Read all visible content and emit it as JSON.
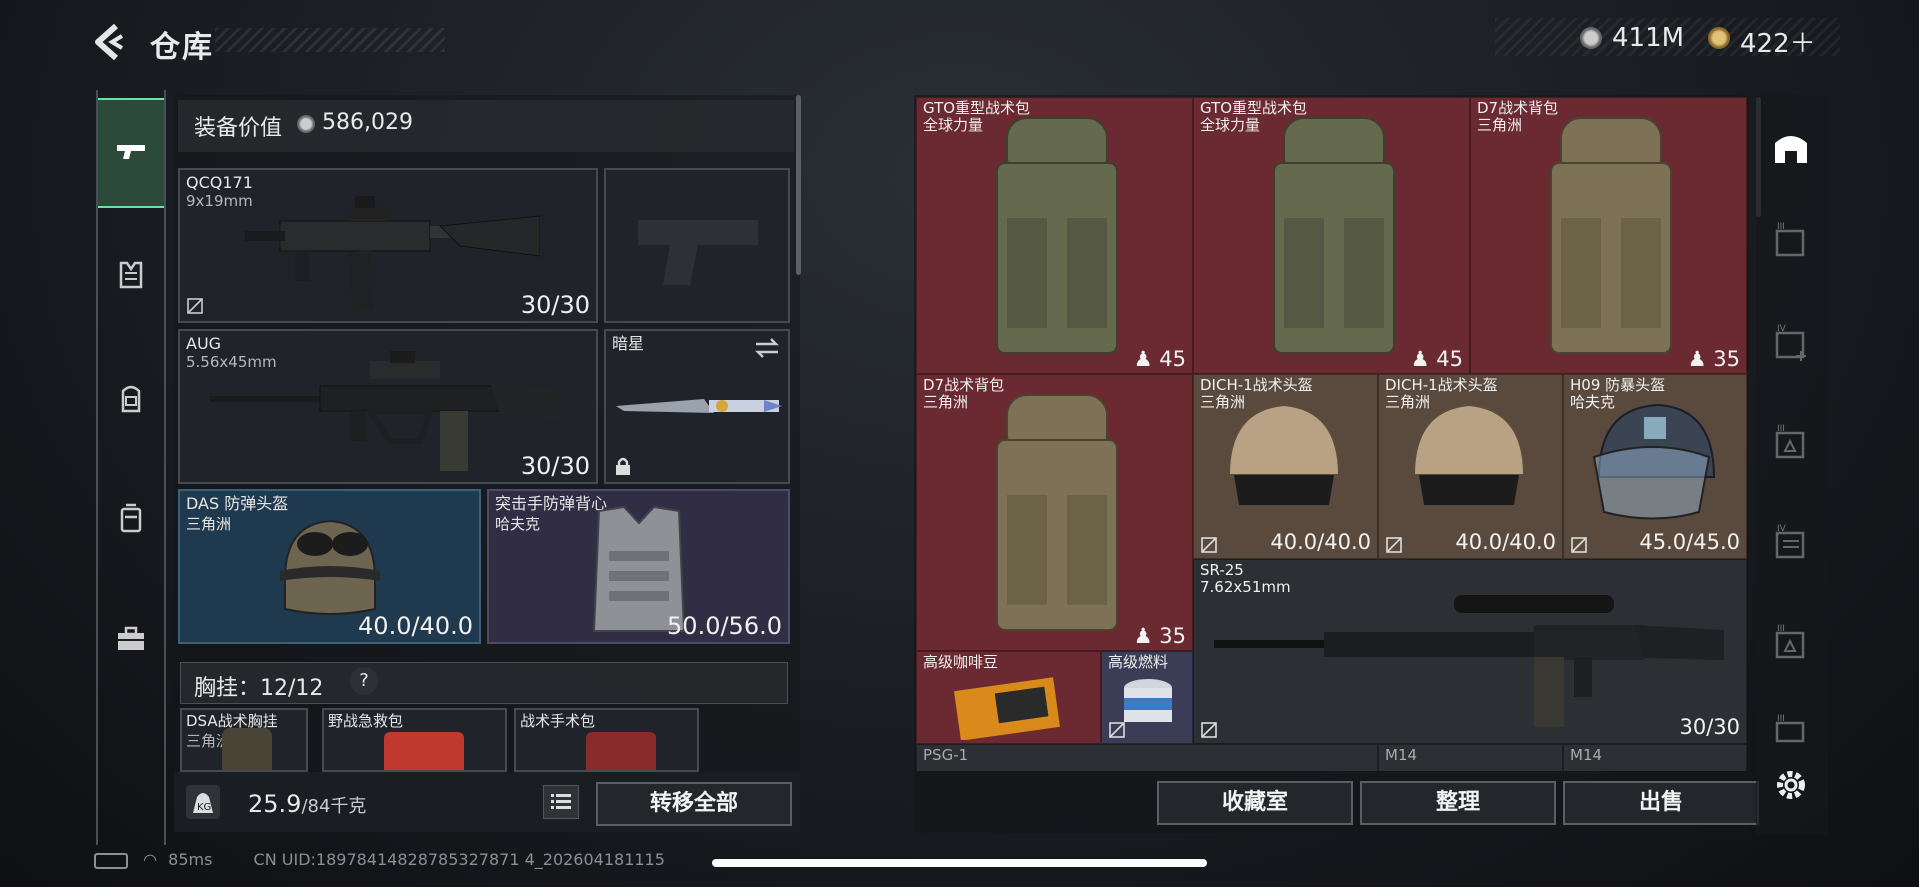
{
  "header": {
    "title": "仓库",
    "currency1": "411M",
    "currency2": "422＋"
  },
  "left_nav": [
    {
      "icon": "pistol-icon",
      "active": true
    },
    {
      "icon": "vest-icon",
      "active": false
    },
    {
      "icon": "backpack-icon",
      "active": false
    },
    {
      "icon": "container-icon",
      "active": false
    },
    {
      "icon": "toolbox-icon",
      "active": false
    }
  ],
  "equipment": {
    "value_label": "装备价值",
    "value": "586,029",
    "primary": {
      "name": "QCQ171",
      "sub": "9x19mm",
      "ammo": "30/30"
    },
    "secondary": {
      "name": "AUG",
      "sub": "5.56x45mm",
      "ammo": "30/30"
    },
    "melee": {
      "name": "暗星"
    },
    "helmet": {
      "name": "DAS 防弹头盔",
      "sub": "三角洲",
      "durability": "40.0/40.0"
    },
    "armor": {
      "name": "突击手防弹背心",
      "sub": "哈夫克",
      "durability": "50.0/56.0"
    },
    "chest": {
      "label": "胸挂：12/12",
      "help": "?"
    },
    "chest_items": [
      {
        "name": "DSA战术胸挂",
        "sub": "三角洲"
      },
      {
        "name": "野战急救包"
      },
      {
        "name": "战术手术包"
      }
    ],
    "weight": "25.9",
    "weight_cap": "/84千克",
    "transfer": "转移全部"
  },
  "storage": {
    "items": [
      {
        "name": "GTO重型战术包",
        "sub": "全球力量",
        "count": "45"
      },
      {
        "name": "GTO重型战术包",
        "sub": "全球力量",
        "count": "45"
      },
      {
        "name": "D7战术背包",
        "sub": "三角洲",
        "count": "35"
      },
      {
        "name": "D7战术背包",
        "sub": "三角洲",
        "count": "35"
      },
      {
        "name": "DICH-1战术头盔",
        "sub": "三角洲",
        "dur": "40.0/40.0"
      },
      {
        "name": "DICH-1战术头盔",
        "sub": "三角洲",
        "dur": "40.0/40.0"
      },
      {
        "name": "H09 防暴头盔",
        "sub": "哈夫克",
        "dur": "45.0/45.0"
      },
      {
        "name": "SR-25",
        "sub": "7.62x51mm",
        "ammo": "30/30"
      },
      {
        "name": "高级咖啡豆"
      },
      {
        "name": "高级燃料"
      },
      {
        "name": "PSG-1"
      },
      {
        "name": "M14"
      },
      {
        "name": "M14"
      }
    ],
    "buttons": {
      "collection": "收藏室",
      "sort": "整理",
      "sell": "出售"
    }
  },
  "status_bar": {
    "ping": "85ms",
    "uid": "CN UID:18978414828785327871 4_202604181115"
  }
}
